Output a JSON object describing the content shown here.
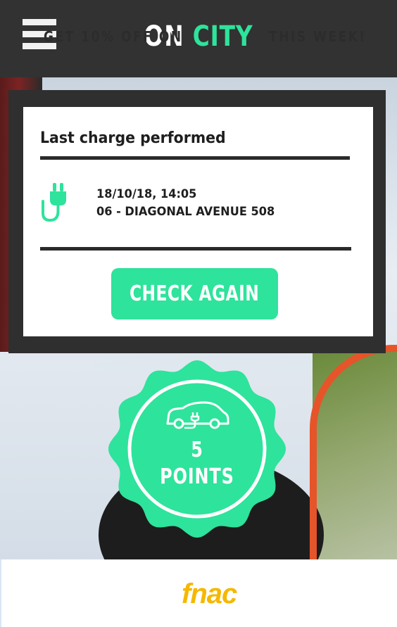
{
  "header": {
    "menu_icon": "hamburger-icon",
    "brand_part1": "ON",
    "brand_part2": "CITY"
  },
  "card": {
    "title": "Last charge performed",
    "charge_icon": "plug-icon",
    "date_time": "18/10/18, 14:05",
    "location": "06 - DIAGONAL AVENUE 508",
    "check_button": "CHECK AGAIN"
  },
  "badge": {
    "icon": "electric-car-icon",
    "points_value": "5",
    "points_label": "POINTS"
  },
  "promo": {
    "text_before": "GET 10% OFF ON",
    "brand": "fnac",
    "text_after": "THIS WEEK!"
  },
  "colors": {
    "accent": "#2ee39b",
    "header_bg": "#323232",
    "fnac": "#f5b800"
  }
}
